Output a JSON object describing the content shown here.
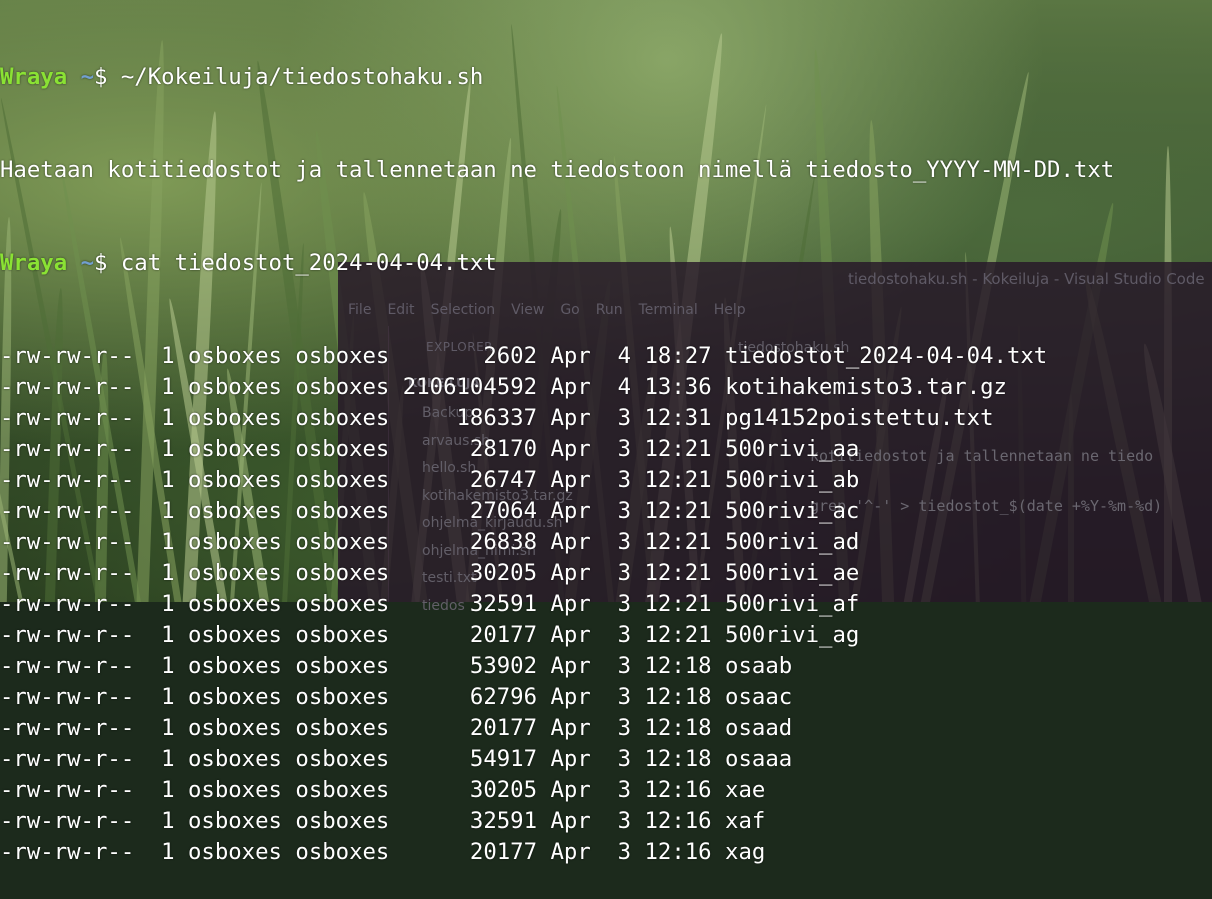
{
  "prompt": {
    "user": "Wraya",
    "path": "~",
    "symbol": "$"
  },
  "commands": [
    "~/Kokeiluja/tiedostohaku.sh",
    "cat tiedostot_2024-04-04.txt"
  ],
  "output_message": "Haetaan kotitiedostot ja tallennetaan ne tiedostoon nimellä tiedosto_YYYY-MM-DD.txt",
  "listing": [
    {
      "perms": "-rw-rw-r--",
      "links": "1",
      "owner": "osboxes",
      "group": "osboxes",
      "size": "2602",
      "month": "Apr",
      "day": "4",
      "time": "18:27",
      "name": "tiedostot_2024-04-04.txt"
    },
    {
      "perms": "-rw-rw-r--",
      "links": "1",
      "owner": "osboxes",
      "group": "osboxes",
      "size": "2106104592",
      "month": "Apr",
      "day": "4",
      "time": "13:36",
      "name": "kotihakemisto3.tar.gz"
    },
    {
      "perms": "-rw-rw-r--",
      "links": "1",
      "owner": "osboxes",
      "group": "osboxes",
      "size": "186337",
      "month": "Apr",
      "day": "3",
      "time": "12:31",
      "name": "pg14152poistettu.txt"
    },
    {
      "perms": "-rw-rw-r--",
      "links": "1",
      "owner": "osboxes",
      "group": "osboxes",
      "size": "28170",
      "month": "Apr",
      "day": "3",
      "time": "12:21",
      "name": "500rivi_aa"
    },
    {
      "perms": "-rw-rw-r--",
      "links": "1",
      "owner": "osboxes",
      "group": "osboxes",
      "size": "26747",
      "month": "Apr",
      "day": "3",
      "time": "12:21",
      "name": "500rivi_ab"
    },
    {
      "perms": "-rw-rw-r--",
      "links": "1",
      "owner": "osboxes",
      "group": "osboxes",
      "size": "27064",
      "month": "Apr",
      "day": "3",
      "time": "12:21",
      "name": "500rivi_ac"
    },
    {
      "perms": "-rw-rw-r--",
      "links": "1",
      "owner": "osboxes",
      "group": "osboxes",
      "size": "26838",
      "month": "Apr",
      "day": "3",
      "time": "12:21",
      "name": "500rivi_ad"
    },
    {
      "perms": "-rw-rw-r--",
      "links": "1",
      "owner": "osboxes",
      "group": "osboxes",
      "size": "30205",
      "month": "Apr",
      "day": "3",
      "time": "12:21",
      "name": "500rivi_ae"
    },
    {
      "perms": "-rw-rw-r--",
      "links": "1",
      "owner": "osboxes",
      "group": "osboxes",
      "size": "32591",
      "month": "Apr",
      "day": "3",
      "time": "12:21",
      "name": "500rivi_af"
    },
    {
      "perms": "-rw-rw-r--",
      "links": "1",
      "owner": "osboxes",
      "group": "osboxes",
      "size": "20177",
      "month": "Apr",
      "day": "3",
      "time": "12:21",
      "name": "500rivi_ag"
    },
    {
      "perms": "-rw-rw-r--",
      "links": "1",
      "owner": "osboxes",
      "group": "osboxes",
      "size": "53902",
      "month": "Apr",
      "day": "3",
      "time": "12:18",
      "name": "osaab"
    },
    {
      "perms": "-rw-rw-r--",
      "links": "1",
      "owner": "osboxes",
      "group": "osboxes",
      "size": "62796",
      "month": "Apr",
      "day": "3",
      "time": "12:18",
      "name": "osaac"
    },
    {
      "perms": "-rw-rw-r--",
      "links": "1",
      "owner": "osboxes",
      "group": "osboxes",
      "size": "20177",
      "month": "Apr",
      "day": "3",
      "time": "12:18",
      "name": "osaad"
    },
    {
      "perms": "-rw-rw-r--",
      "links": "1",
      "owner": "osboxes",
      "group": "osboxes",
      "size": "54917",
      "month": "Apr",
      "day": "3",
      "time": "12:18",
      "name": "osaaa"
    },
    {
      "perms": "-rw-rw-r--",
      "links": "1",
      "owner": "osboxes",
      "group": "osboxes",
      "size": "30205",
      "month": "Apr",
      "day": "3",
      "time": "12:16",
      "name": "xae"
    },
    {
      "perms": "-rw-rw-r--",
      "links": "1",
      "owner": "osboxes",
      "group": "osboxes",
      "size": "32591",
      "month": "Apr",
      "day": "3",
      "time": "12:16",
      "name": "xaf"
    },
    {
      "perms": "-rw-rw-r--",
      "links": "1",
      "owner": "osboxes",
      "group": "osboxes",
      "size": "20177",
      "month": "Apr",
      "day": "3",
      "time": "12:16",
      "name": "xag"
    }
  ],
  "background_window": {
    "title": "tiedostohaku.sh - Kokeiluja - Visual Studio Code",
    "menu": [
      "File",
      "Edit",
      "Selection",
      "View",
      "Go",
      "Run",
      "Terminal",
      "Help"
    ],
    "explorer_label": "EXPLORER",
    "folder": "KOKEILUJA",
    "files": [
      "Backup",
      "arvaus.sh",
      "hello.sh",
      "kotihakemisto3.tar.gz",
      "ohjelma_kirjaudu.sh",
      "ohjelma_nimi.sh",
      "testi.txt",
      "tiedos"
    ],
    "tab": "tiedostohaku.sh",
    "code_lines": [
      "kotitiedostot ja tallennetaan ne tiedo",
      "grep '^-' > tiedostot_$(date +%Y-%m-%d)"
    ]
  },
  "colors": {
    "user": "#8ae234",
    "path": "#729fcf",
    "text": "#ffffff"
  }
}
